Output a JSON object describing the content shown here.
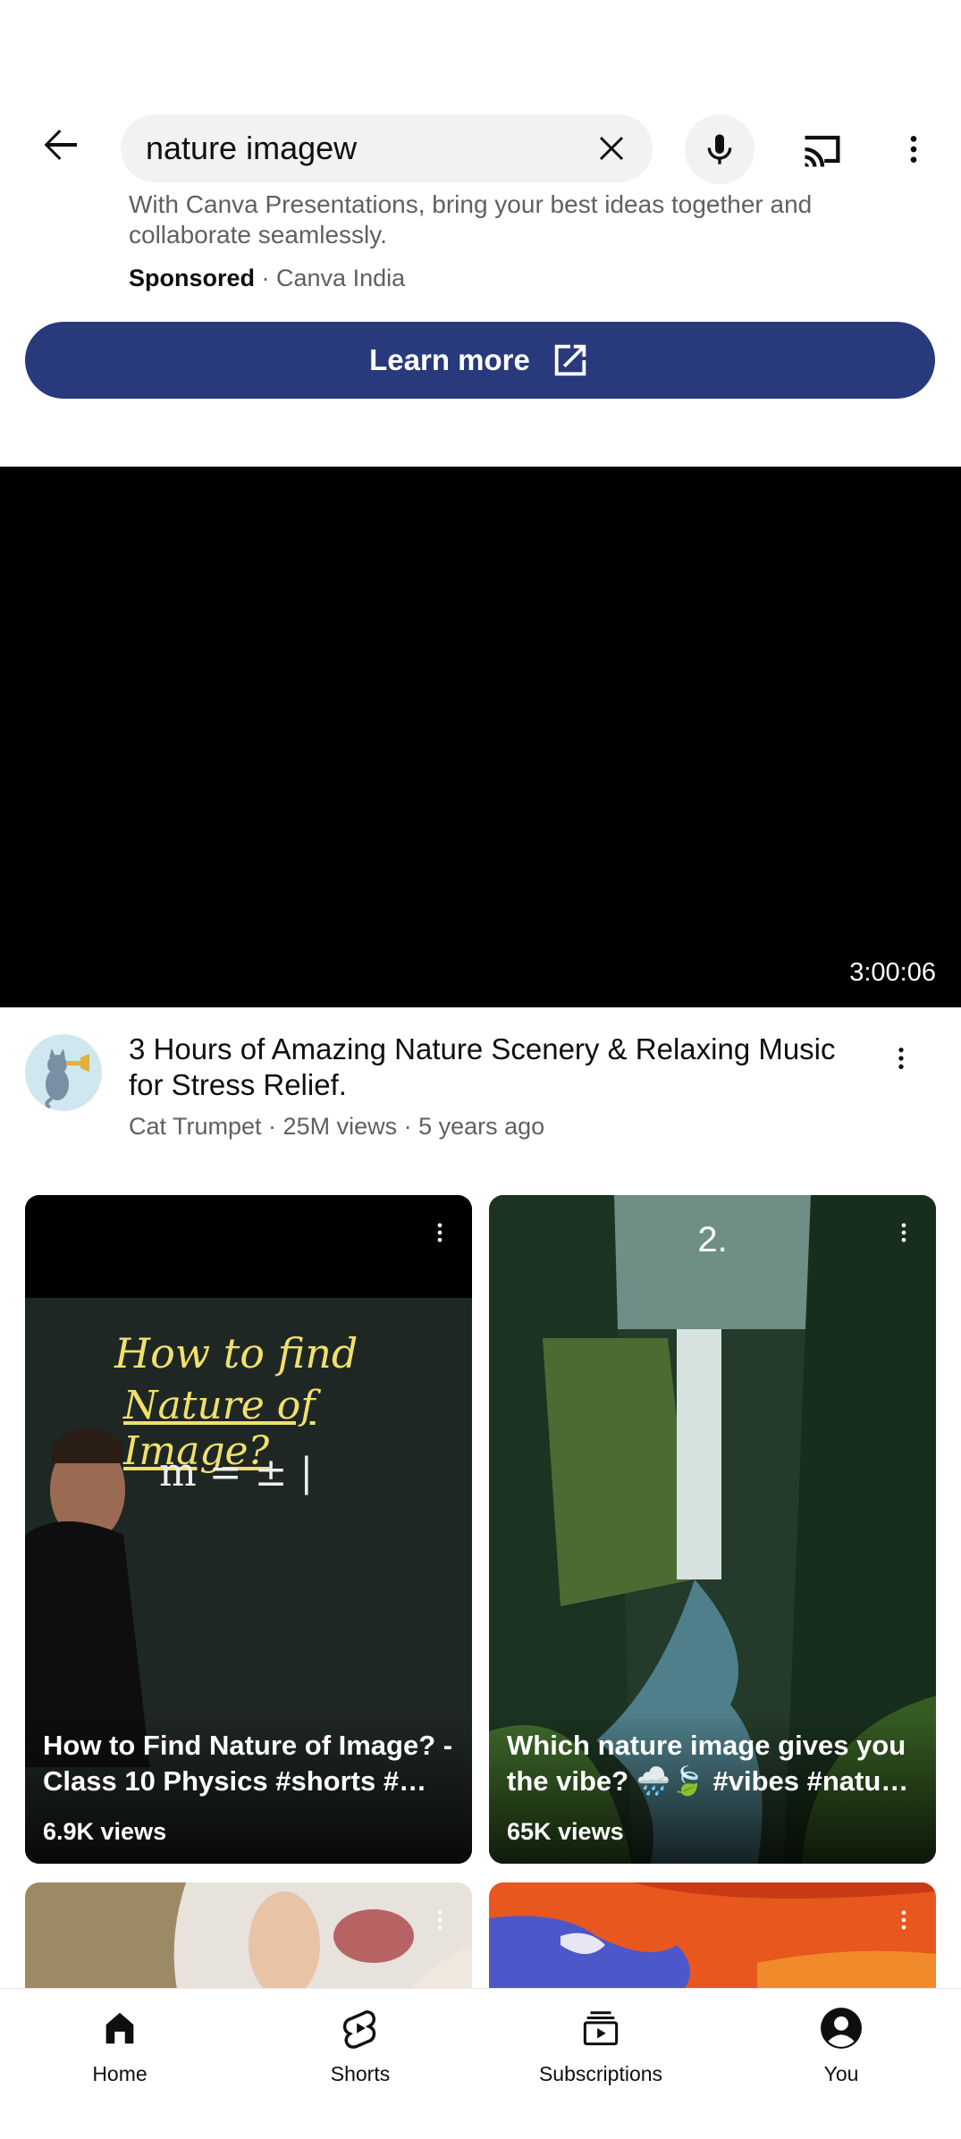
{
  "search": {
    "query": "nature imagew"
  },
  "ad": {
    "description": "With Canva Presentations, bring your best ideas together and collaborate seamlessly.",
    "sponsored_label": "Sponsored",
    "separator": " · ",
    "advertiser": "Canva India",
    "cta_label": "Learn more",
    "cta_color": "#283a7c"
  },
  "video": {
    "duration": "3:00:06",
    "title": "3 Hours of Amazing Nature Scenery & Relaxing Music for Stress Relief.",
    "meta": "Cat Trumpet · 25M views · 5 years ago"
  },
  "shorts": [
    {
      "title": "How to Find Nature of Image? - Class 10 Physics #shorts #…",
      "views": "6.9K views",
      "board_line1": "How to find",
      "board_line2": "Nature of Image?",
      "board_formula": "m = ± |"
    },
    {
      "title": "Which nature image gives you the vibe? 🌧️🍃 #vibes #natu…",
      "views": "65K views",
      "rank": "2."
    }
  ],
  "nav": {
    "items": [
      {
        "label": "Home",
        "icon": "home-icon"
      },
      {
        "label": "Shorts",
        "icon": "shorts-icon"
      },
      {
        "label": "Subscriptions",
        "icon": "subscriptions-icon"
      },
      {
        "label": "You",
        "icon": "account-icon"
      }
    ]
  }
}
